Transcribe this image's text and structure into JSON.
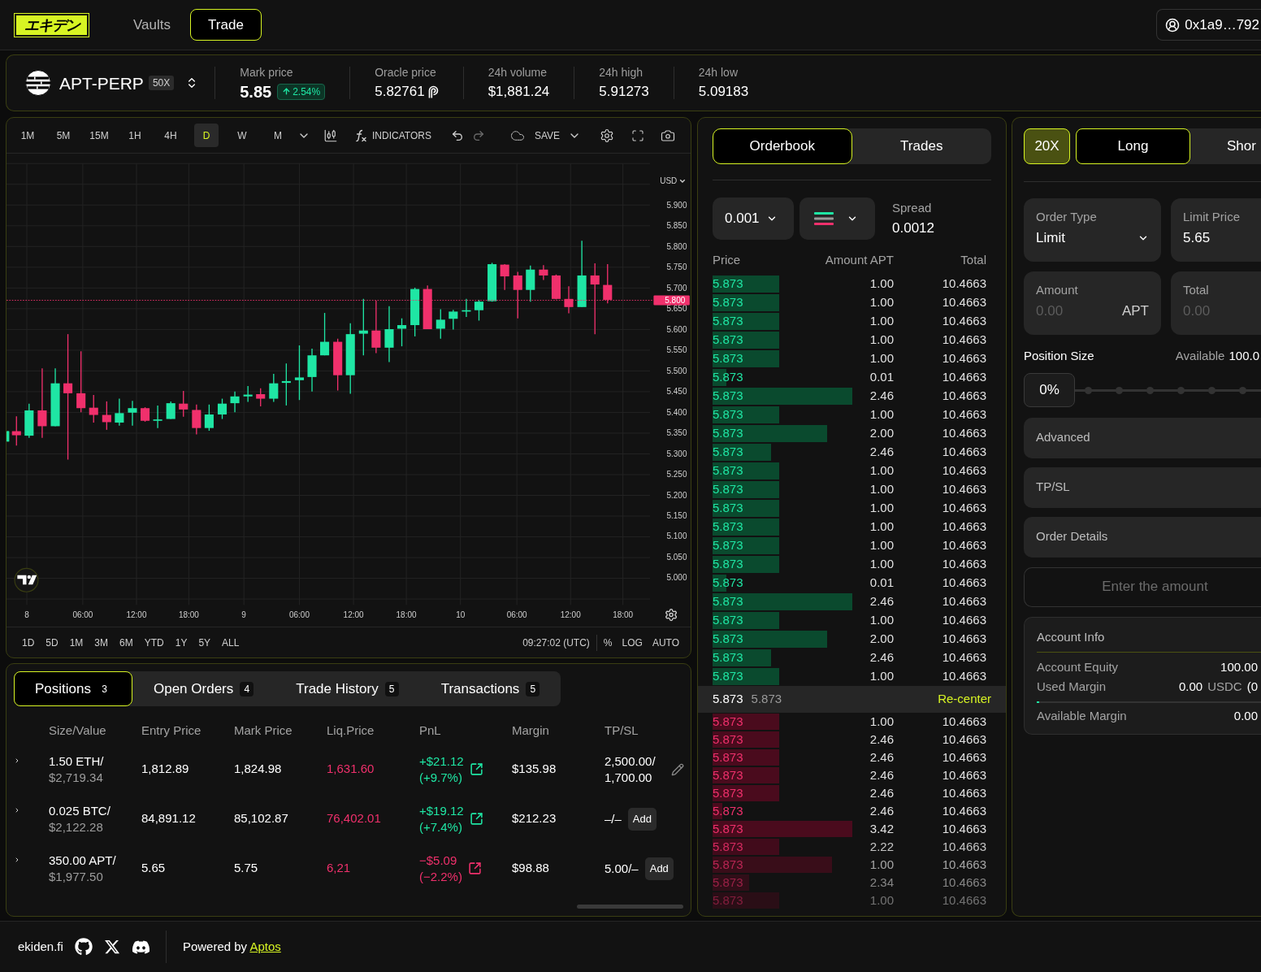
{
  "nav": {
    "logo": "エキデン",
    "links": [
      {
        "label": "Vaults",
        "selected": false
      },
      {
        "label": "Trade",
        "selected": true
      }
    ],
    "account": "0x1a9…792"
  },
  "market": {
    "symbol": "APT-PERP",
    "leverage": "50X",
    "stats": [
      {
        "kind": "mark",
        "label": "Mark price",
        "value": "5.85",
        "change": "2.54%",
        "positive": true
      },
      {
        "kind": "oracle",
        "label": "Oracle price",
        "value": "5.82761"
      },
      {
        "kind": "plain",
        "label": "24h volume",
        "value": "$1,881.24"
      },
      {
        "kind": "plain",
        "label": "24h high",
        "value": "5.91273"
      },
      {
        "kind": "plain",
        "label": "24h low",
        "value": "5.09183"
      }
    ]
  },
  "chart": {
    "intervals": [
      {
        "label": "1M",
        "selected": false
      },
      {
        "label": "5M",
        "selected": false
      },
      {
        "label": "15M",
        "selected": false
      },
      {
        "label": "1H",
        "selected": false
      },
      {
        "label": "4H",
        "selected": false
      },
      {
        "label": "D",
        "selected": true
      },
      {
        "label": "W",
        "selected": false
      },
      {
        "label": "M",
        "selected": false
      }
    ],
    "indicators": "INDICATORS",
    "save": "SAVE",
    "currency": "USD",
    "price_ticks": [
      "5.900",
      "5.850",
      "5.800",
      "5.750",
      "5.700",
      "5.650",
      "5.600",
      "5.550",
      "5.500",
      "5.450",
      "5.400",
      "5.350",
      "5.300",
      "5.250",
      "5.200",
      "5.150",
      "5.100",
      "5.050",
      "5.000"
    ],
    "last_price": "5.800",
    "time_ticks": [
      "8",
      "06:00",
      "12:00",
      "18:00",
      "9",
      "06:00",
      "12:00",
      "18:00",
      "10",
      "06:00",
      "12:00",
      "18:00"
    ],
    "ranges": [
      "1D",
      "5D",
      "1M",
      "3M",
      "6M",
      "YTD",
      "1Y",
      "5Y",
      "ALL"
    ],
    "clock": "09:27:02 (UTC)",
    "scale_options": [
      "%",
      "LOG",
      "AUTO"
    ]
  },
  "orderbook": {
    "tabs": [
      {
        "label": "Orderbook",
        "selected": true
      },
      {
        "label": "Trades",
        "selected": false
      }
    ],
    "tick_size": "0.001",
    "spread_label": "Spread",
    "spread": "0.0012",
    "columns": [
      "Price",
      "Amount APT",
      "Total"
    ],
    "upper_levels": [
      {
        "price": "5.873",
        "amount": "1.00",
        "total": "10.4663",
        "level": 0.24
      },
      {
        "price": "5.873",
        "amount": "1.00",
        "total": "10.4663",
        "level": 0.24
      },
      {
        "price": "5.873",
        "amount": "1.00",
        "total": "10.4663",
        "level": 0.24
      },
      {
        "price": "5.873",
        "amount": "1.00",
        "total": "10.4663",
        "level": 0.24
      },
      {
        "price": "5.873",
        "amount": "1.00",
        "total": "10.4663",
        "level": 0.24
      },
      {
        "price": "5.873",
        "amount": "0.01",
        "total": "10.4663",
        "level": 0.05
      },
      {
        "price": "5.873",
        "amount": "2.46",
        "total": "10.4663",
        "level": 0.5
      },
      {
        "price": "5.873",
        "amount": "1.00",
        "total": "10.4663",
        "level": 0.24
      },
      {
        "price": "5.873",
        "amount": "2.00",
        "total": "10.4663",
        "level": 0.41
      },
      {
        "price": "5.873",
        "amount": "2.46",
        "total": "10.4663",
        "level": 0.21
      },
      {
        "price": "5.873",
        "amount": "1.00",
        "total": "10.4663",
        "level": 0.24
      },
      {
        "price": "5.873",
        "amount": "1.00",
        "total": "10.4663",
        "level": 0.24
      },
      {
        "price": "5.873",
        "amount": "1.00",
        "total": "10.4663",
        "level": 0.24
      },
      {
        "price": "5.873",
        "amount": "1.00",
        "total": "10.4663",
        "level": 0.24
      },
      {
        "price": "5.873",
        "amount": "1.00",
        "total": "10.4663",
        "level": 0.24
      },
      {
        "price": "5.873",
        "amount": "1.00",
        "total": "10.4663",
        "level": 0.24
      },
      {
        "price": "5.873",
        "amount": "0.01",
        "total": "10.4663",
        "level": 0.05
      },
      {
        "price": "5.873",
        "amount": "2.46",
        "total": "10.4663",
        "level": 0.5
      },
      {
        "price": "5.873",
        "amount": "1.00",
        "total": "10.4663",
        "level": 0.24
      },
      {
        "price": "5.873",
        "amount": "2.00",
        "total": "10.4663",
        "level": 0.41
      },
      {
        "price": "5.873",
        "amount": "2.46",
        "total": "10.4663",
        "level": 0.21
      },
      {
        "price": "5.873",
        "amount": "1.00",
        "total": "10.4663",
        "level": 0.24
      }
    ],
    "mid": {
      "price": "5.873",
      "mark": "5.873",
      "action": "Re-center"
    },
    "lower_levels": [
      {
        "price": "5.873",
        "amount": "1.00",
        "total": "10.4663",
        "level": 0.24
      },
      {
        "price": "5.873",
        "amount": "2.46",
        "total": "10.4663",
        "level": 0.24
      },
      {
        "price": "5.873",
        "amount": "2.46",
        "total": "10.4663",
        "level": 0.24
      },
      {
        "price": "5.873",
        "amount": "2.46",
        "total": "10.4663",
        "level": 0.24
      },
      {
        "price": "5.873",
        "amount": "2.46",
        "total": "10.4663",
        "level": 0.24
      },
      {
        "price": "5.873",
        "amount": "2.46",
        "total": "10.4663",
        "level": 0.035
      },
      {
        "price": "5.873",
        "amount": "3.42",
        "total": "10.4663",
        "level": 0.5
      },
      {
        "price": "5.873",
        "amount": "2.22",
        "total": "10.4663",
        "level": 0.24
      },
      {
        "price": "5.873",
        "amount": "1.00",
        "total": "10.4663",
        "level": 0.43
      },
      {
        "price": "5.873",
        "amount": "2.34",
        "total": "10.4663",
        "level": 0.13
      },
      {
        "price": "5.873",
        "amount": "1.00",
        "total": "10.4663",
        "level": 0.24
      }
    ]
  },
  "order_form": {
    "leverage": "20X",
    "sides": [
      {
        "label": "Long",
        "selected": true
      },
      {
        "label": "Shor",
        "selected": false
      }
    ],
    "fields": [
      {
        "kind": "select",
        "label": "Order Type",
        "value": "Limit"
      },
      {
        "kind": "input",
        "label": "Limit Price",
        "value": "5.65"
      },
      {
        "kind": "input",
        "label": "Amount",
        "placeholder": "0.00",
        "unit": "APT"
      },
      {
        "kind": "input",
        "label": "Total",
        "placeholder": "0.00"
      }
    ],
    "position_size": {
      "label": "Position Size",
      "available_label": "Available",
      "available": "100.0",
      "value": "0%",
      "level": 0
    },
    "sections": [
      "Advanced",
      "TP/SL",
      "Order Details"
    ],
    "submit": {
      "label": "Enter the amount",
      "disabled": true
    },
    "account_info": {
      "title": "Account Info",
      "rows": [
        {
          "kind": "value",
          "label": "Account Equity",
          "value": "100.00"
        },
        {
          "kind": "value",
          "label": "Used Margin",
          "value": "0.00",
          "unit": "USDC",
          "extra": "(0"
        },
        {
          "kind": "meter",
          "level": 0.01
        },
        {
          "kind": "value",
          "label": "Available Margin",
          "value": "0.00"
        }
      ]
    }
  },
  "positions": {
    "tabs": [
      {
        "label": "Positions",
        "count": "3",
        "selected": true
      },
      {
        "label": "Open Orders",
        "count": "4",
        "selected": false
      },
      {
        "label": "Trade History",
        "count": "5",
        "selected": false
      },
      {
        "label": "Transactions",
        "count": "5",
        "selected": false
      }
    ],
    "columns": [
      "Size/Value",
      "Entry Price",
      "Mark Price",
      "Liq.Price",
      "PnL",
      "Margin",
      "TP/SL"
    ],
    "rows": [
      {
        "size": "1.50 ETH/",
        "value": "$2,719.34",
        "entry": "1,812.89",
        "mark": "1,824.98",
        "liq": "1,631.60",
        "pnl": "+$21.12",
        "pnl_pct": "(+9.7%)",
        "positive": true,
        "margin": "$135.98",
        "tpsl": [
          "2,500.00/",
          "1,700.00"
        ],
        "action": {
          "kind": "edit"
        }
      },
      {
        "size": "0.025 BTC/",
        "value": "$2,122.28",
        "entry": "84,891.12",
        "mark": "85,102.87",
        "liq": "76,402.01",
        "pnl": "+$19.12",
        "pnl_pct": "(+7.4%)",
        "positive": true,
        "margin": "$212.23",
        "tpsl": [
          "–/–"
        ],
        "action": {
          "kind": "add",
          "label": "Add"
        }
      },
      {
        "size": "350.00 APT/",
        "value": "$1,977.50",
        "entry": "5.65",
        "mark": "5.75",
        "liq": "6,21",
        "pnl": "−$5.09",
        "pnl_pct": "(−2.2%)",
        "positive": false,
        "margin": "$98.88",
        "tpsl": [
          "5.00/–"
        ],
        "action": {
          "kind": "add",
          "label": "Add"
        }
      }
    ]
  },
  "footer": {
    "site": "ekiden.fi",
    "powered_by": "Powered by",
    "link": "Aptos"
  }
}
